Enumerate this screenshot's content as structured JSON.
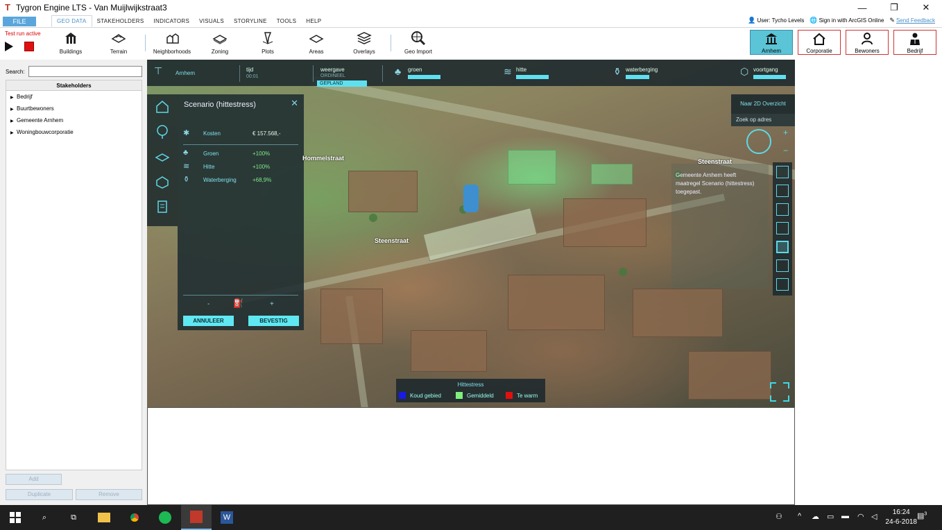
{
  "window": {
    "title": "Tygron Engine LTS - Van Muijlwijkstraat3"
  },
  "menu": {
    "file": "FILE",
    "items": [
      "GEO DATA",
      "STAKEHOLDERS",
      "INDICATORS",
      "VISUALS",
      "STORYLINE",
      "TOOLS",
      "HELP"
    ],
    "active": "GEO DATA",
    "user": "User: Tycho Levels",
    "arcgis": "Sign in with ArcGIS Online",
    "feedback": "Send Feedback"
  },
  "toolbar": {
    "test_run": "Test run active",
    "tools": [
      "Buildings",
      "Terrain",
      "Neighborhoods",
      "Zoning",
      "Plots",
      "Areas",
      "Overlays",
      "Geo Import"
    ],
    "stakeholders": [
      "Arnhem",
      "Corporatie",
      "Bewoners",
      "Bedrijf"
    ]
  },
  "left_panel": {
    "search_label": "Search:",
    "search_value": "",
    "tree_header": "Stakeholders",
    "tree_items": [
      "Bedrijf",
      "Buurtbewoners",
      "Gemeente Arnhem",
      "Woningbouwcorporatie"
    ],
    "buttons": {
      "add": "Add",
      "duplicate": "Duplicate",
      "remove": "Remove"
    }
  },
  "hud": {
    "stakeholder": "Arnhem",
    "time_label": "tijd",
    "time_value": "00:01",
    "view_label": "weergave",
    "view_sub": "ORDINEEL",
    "view_state": "GEPLAND",
    "indicators": [
      {
        "name": "groen",
        "fill": 0.9
      },
      {
        "name": "hitte",
        "fill": 0.9
      },
      {
        "name": "waterberging",
        "fill": 0.66
      },
      {
        "name": "voortgang",
        "fill": 0.9
      }
    ]
  },
  "scenario": {
    "title": "Scenario (hittestress)",
    "cost_label": "Kosten",
    "cost_value": "€ 157.568,-",
    "rows": [
      {
        "label": "Groen",
        "value": "+100%"
      },
      {
        "label": "Hitte",
        "value": "+100%"
      },
      {
        "label": "Waterberging",
        "value": "+68,9%"
      }
    ],
    "cancel": "ANNULEER",
    "confirm": "BEVESTIG",
    "minus": "-",
    "plus": "+"
  },
  "map": {
    "btn_2d": "Naar 2D Overzicht",
    "address_search": "Zoek op adres",
    "zoom_in": "+",
    "zoom_out": "−",
    "street_labels": [
      "Hommelstraat",
      "Steenstraat",
      "Steenstraat"
    ],
    "notification": "Gemeente Arnhem heeft maatregel Scenario (hittestress) toegepast.",
    "legend": {
      "title": "Hittestress",
      "items": [
        {
          "label": "Koud gebied",
          "color": "#1a1ae6"
        },
        {
          "label": "Gemiddeld",
          "color": "#7ef07e"
        },
        {
          "label": "Te warm",
          "color": "#e01010"
        }
      ]
    }
  },
  "taskbar": {
    "time": "16:24",
    "date": "24-6-2018",
    "notifications": "3"
  }
}
